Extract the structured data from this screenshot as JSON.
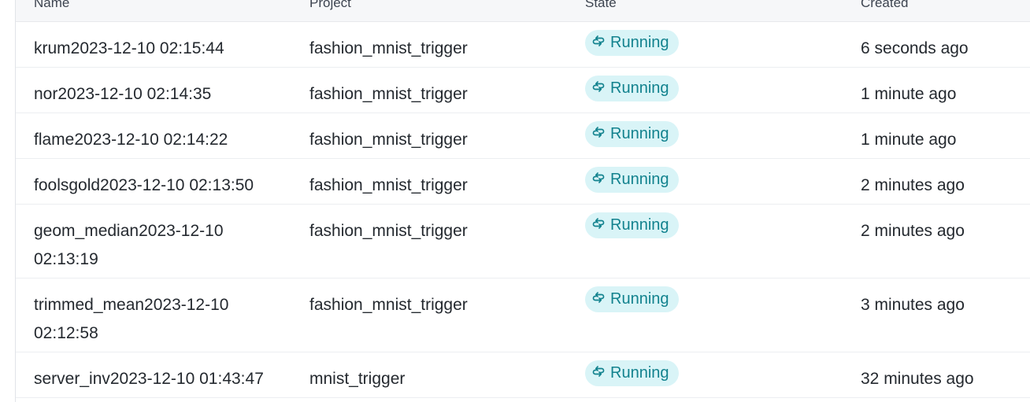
{
  "columns": {
    "name": "Name",
    "project": "Project",
    "state": "State",
    "created": "Created"
  },
  "state_icon": "sync-arrows-icon",
  "colors": {
    "badge_bg": "#d9f4f7",
    "badge_text": "#12828e"
  },
  "rows": [
    {
      "name": "krum2023-12-10 02:15:44",
      "project": "fashion_mnist_trigger",
      "state": "Running",
      "created": "6 seconds ago"
    },
    {
      "name": "nor2023-12-10 02:14:35",
      "project": "fashion_mnist_trigger",
      "state": "Running",
      "created": "1 minute ago"
    },
    {
      "name": "flame2023-12-10 02:14:22",
      "project": "fashion_mnist_trigger",
      "state": "Running",
      "created": "1 minute ago"
    },
    {
      "name": "foolsgold2023-12-10 02:13:50",
      "project": "fashion_mnist_trigger",
      "state": "Running",
      "created": "2 minutes ago"
    },
    {
      "name": "geom_median2023-12-10 02:13:19",
      "project": "fashion_mnist_trigger",
      "state": "Running",
      "created": "2 minutes ago"
    },
    {
      "name": "trimmed_mean2023-12-10 02:12:58",
      "project": "fashion_mnist_trigger",
      "state": "Running",
      "created": "3 minutes ago"
    },
    {
      "name": "server_inv2023-12-10 01:43:47",
      "project": "mnist_trigger",
      "state": "Running",
      "created": "32 minutes ago"
    }
  ]
}
